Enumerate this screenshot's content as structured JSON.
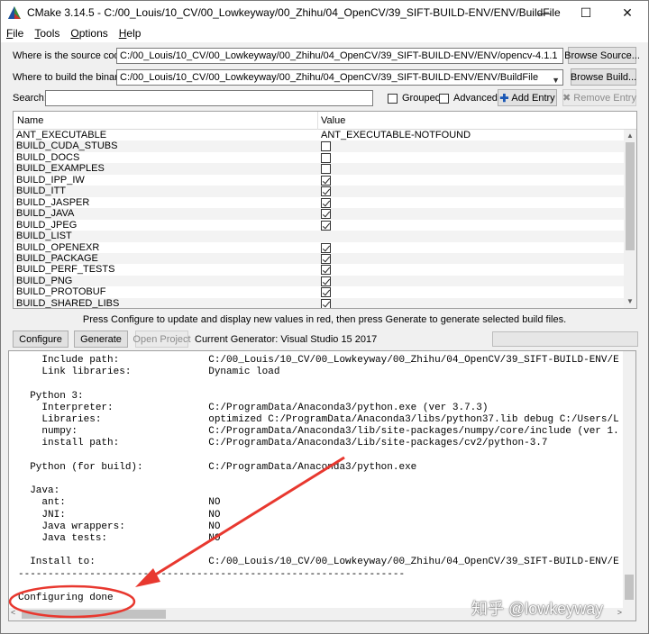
{
  "window": {
    "title": "CMake 3.14.5 - C:/00_Louis/10_CV/00_Lowkeyway/00_Zhihu/04_OpenCV/39_SIFT-BUILD-ENV/ENV/BuildFile",
    "minimize": "—",
    "maximize": "☐",
    "close": "✕"
  },
  "menu": {
    "file": {
      "ul": "F",
      "rest": "ile"
    },
    "tools": {
      "ul": "T",
      "rest": "ools"
    },
    "options": {
      "ul": "O",
      "rest": "ptions"
    },
    "help": {
      "ul": "H",
      "rest": "elp"
    }
  },
  "source": {
    "label": "Where is the source code:",
    "value": "C:/00_Louis/10_CV/00_Lowkeyway/00_Zhihu/04_OpenCV/39_SIFT-BUILD-ENV/ENV/opencv-4.1.1",
    "browse": "Browse Source..."
  },
  "build": {
    "label": "Where to build the binaries:",
    "value": "C:/00_Louis/10_CV/00_Lowkeyway/00_Zhihu/04_OpenCV/39_SIFT-BUILD-ENV/ENV/BuildFile",
    "browse": "Browse Build..."
  },
  "search": {
    "label": "Search:",
    "value": "",
    "grouped": "Grouped",
    "advanced": "Advanced",
    "add_entry": "Add Entry",
    "remove_entry": "Remove Entry"
  },
  "table": {
    "col_name": "Name",
    "col_value": "Value",
    "rows": [
      {
        "name": "ANT_EXECUTABLE",
        "type": "text",
        "value": "ANT_EXECUTABLE-NOTFOUND"
      },
      {
        "name": "BUILD_CUDA_STUBS",
        "type": "bool",
        "checked": false
      },
      {
        "name": "BUILD_DOCS",
        "type": "bool",
        "checked": false
      },
      {
        "name": "BUILD_EXAMPLES",
        "type": "bool",
        "checked": false
      },
      {
        "name": "BUILD_IPP_IW",
        "type": "bool",
        "checked": true
      },
      {
        "name": "BUILD_ITT",
        "type": "bool",
        "checked": true
      },
      {
        "name": "BUILD_JASPER",
        "type": "bool",
        "checked": true
      },
      {
        "name": "BUILD_JAVA",
        "type": "bool",
        "checked": true
      },
      {
        "name": "BUILD_JPEG",
        "type": "bool",
        "checked": true
      },
      {
        "name": "BUILD_LIST",
        "type": "text",
        "value": ""
      },
      {
        "name": "BUILD_OPENEXR",
        "type": "bool",
        "checked": true
      },
      {
        "name": "BUILD_PACKAGE",
        "type": "bool",
        "checked": true
      },
      {
        "name": "BUILD_PERF_TESTS",
        "type": "bool",
        "checked": true
      },
      {
        "name": "BUILD_PNG",
        "type": "bool",
        "checked": true
      },
      {
        "name": "BUILD_PROTOBUF",
        "type": "bool",
        "checked": true
      },
      {
        "name": "BUILD_SHARED_LIBS",
        "type": "bool",
        "checked": true
      }
    ]
  },
  "hint": "Press Configure to update and display new values in red, then press Generate to generate selected build files.",
  "actions": {
    "configure": "Configure",
    "generate": "Generate",
    "open_project": "Open Project",
    "generator": "Current Generator: Visual Studio 15 2017"
  },
  "output": {
    "lines": [
      "    Include path:               C:/00_Louis/10_CV/00_Lowkeyway/00_Zhihu/04_OpenCV/39_SIFT-BUILD-ENV/E",
      "    Link libraries:             Dynamic load",
      "",
      "  Python 3:",
      "    Interpreter:                C:/ProgramData/Anaconda3/python.exe (ver 3.7.3)",
      "    Libraries:                  optimized C:/ProgramData/Anaconda3/libs/python37.lib debug C:/Users/L",
      "    numpy:                      C:/ProgramData/Anaconda3/lib/site-packages/numpy/core/include (ver 1.",
      "    install path:               C:/ProgramData/Anaconda3/Lib/site-packages/cv2/python-3.7",
      "",
      "  Python (for build):           C:/ProgramData/Anaconda3/python.exe",
      "",
      "  Java:",
      "    ant:                        NO",
      "    JNI:                        NO",
      "    Java wrappers:              NO",
      "    Java tests:                 NO",
      "",
      "  Install to:                   C:/00_Louis/10_CV/00_Lowkeyway/00_Zhihu/04_OpenCV/39_SIFT-BUILD-ENV/E",
      "-----------------------------------------------------------------",
      "",
      "Configuring done"
    ]
  },
  "watermark": "知乎 @lowkeyway",
  "colors": {
    "annotation": "#e8382f",
    "accent_blue": "#1a57b5"
  }
}
